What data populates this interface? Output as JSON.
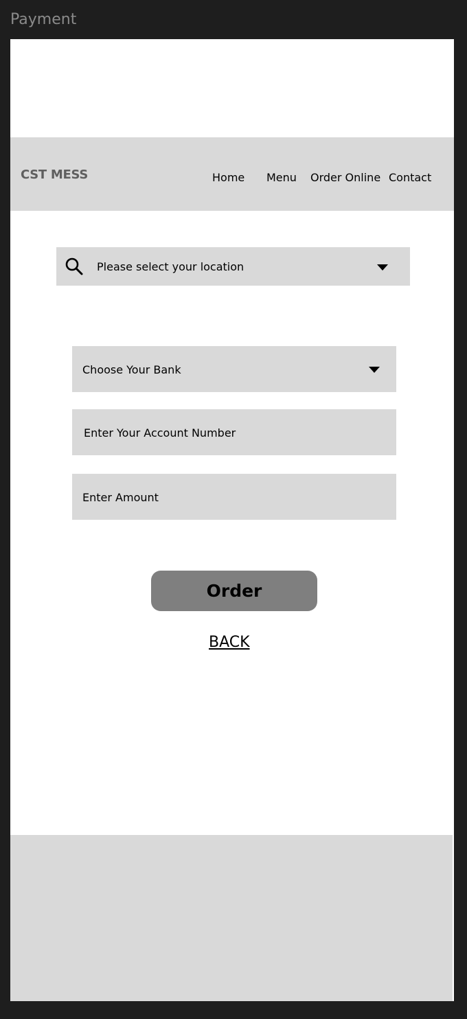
{
  "frame": {
    "title": "Payment"
  },
  "navbar": {
    "brand": "CST MESS",
    "links": [
      {
        "label": "Home"
      },
      {
        "label": "Menu"
      },
      {
        "label": "Order Online"
      },
      {
        "label": "Contact"
      }
    ]
  },
  "location": {
    "placeholder": "Please select your location",
    "icon": "search-icon"
  },
  "form": {
    "bank_select": "Choose Your Bank",
    "account_number": "Enter Your Account Number",
    "amount": "Enter Amount"
  },
  "actions": {
    "order_label": "Order",
    "back_label": "BACK"
  },
  "colors": {
    "background": "#1e1e1e",
    "page": "#ffffff",
    "panel": "#d9d9d9",
    "button": "#7f7f7f",
    "brand_text": "#5f5f5f"
  }
}
